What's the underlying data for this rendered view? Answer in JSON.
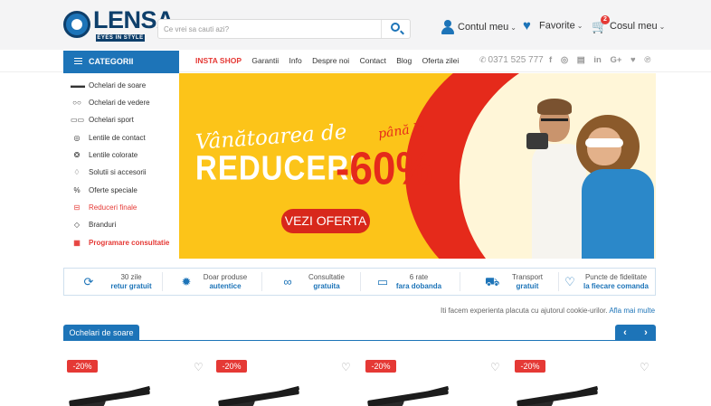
{
  "header": {
    "logo_text": "LENSA",
    "logo_tagline": "EYES IN STYLE",
    "search_placeholder": "Ce vrei sa cauti azi?",
    "account_label": "Contul meu",
    "favorites_label": "Favorite",
    "cart_label": "Cosul meu",
    "cart_count": "2"
  },
  "nav": {
    "categories_label": "CATEGORII",
    "links": [
      "INSTA SHOP",
      "Garantii",
      "Info",
      "Despre noi",
      "Contact",
      "Blog",
      "Oferta zilei"
    ],
    "phone": "0371 525 777",
    "socials": [
      "f",
      "◎",
      "▤",
      "in",
      "G+",
      "♥",
      "℗"
    ]
  },
  "sidebar": {
    "items": [
      {
        "label": "Ochelari de soare",
        "icon": "sunglasses-icon",
        "glyph": "▬▬"
      },
      {
        "label": "Ochelari de vedere",
        "icon": "eyeglasses-icon",
        "glyph": "○○"
      },
      {
        "label": "Ochelari sport",
        "icon": "sport-glasses-icon",
        "glyph": "▭▭"
      },
      {
        "label": "Lentile de contact",
        "icon": "contact-lens-icon",
        "glyph": "◎"
      },
      {
        "label": "Lentile colorate",
        "icon": "colored-lens-icon",
        "glyph": "❂"
      },
      {
        "label": "Solutii si accesorii",
        "icon": "drop-icon",
        "glyph": "♢"
      },
      {
        "label": "Oferte speciale",
        "icon": "percent-icon",
        "glyph": "%"
      },
      {
        "label": "Reduceri finale",
        "icon": "basket-icon",
        "glyph": "⊟"
      },
      {
        "label": "Branduri",
        "icon": "tag-icon",
        "glyph": "◇"
      },
      {
        "label": "Programare consultatie",
        "icon": "calendar-icon",
        "glyph": "▦"
      }
    ]
  },
  "banner": {
    "script_text": "Vânătoarea de",
    "pana_la": "până la",
    "headline": "REDUCERI",
    "discount": "-60%",
    "cta": "VEZI OFERTA",
    "colors": {
      "yellow": "#fcc419",
      "red": "#e52a1b"
    }
  },
  "benefits": [
    {
      "line1": "30 zile",
      "line2": "retur gratuit",
      "icon": "return-icon"
    },
    {
      "line1": "Doar produse",
      "line2": "autentice",
      "icon": "badge-icon"
    },
    {
      "line1": "Consultatie",
      "line2": "gratuita",
      "icon": "binoculars-icon"
    },
    {
      "line1": "6 rate",
      "line2": "fara dobanda",
      "icon": "card-icon"
    },
    {
      "line1": "Transport",
      "line2": "gratuit",
      "icon": "truck-icon"
    },
    {
      "line1": "Puncte de fidelitate",
      "line2": "la fiecare comanda",
      "icon": "heart-outline-icon"
    }
  ],
  "cookie": {
    "text": "Iti facem experienta placuta cu ajutorul cookie-urilor.",
    "link": "Afla mai multe"
  },
  "section": {
    "title": "Ochelari de soare",
    "prev": "‹",
    "next": "›"
  },
  "products": [
    {
      "discount": "-20%"
    },
    {
      "discount": "-20%"
    },
    {
      "discount": "-20%"
    },
    {
      "discount": "-20%"
    }
  ],
  "colors": {
    "brand_blue": "#1d74b8",
    "accent_red": "#e53935"
  }
}
